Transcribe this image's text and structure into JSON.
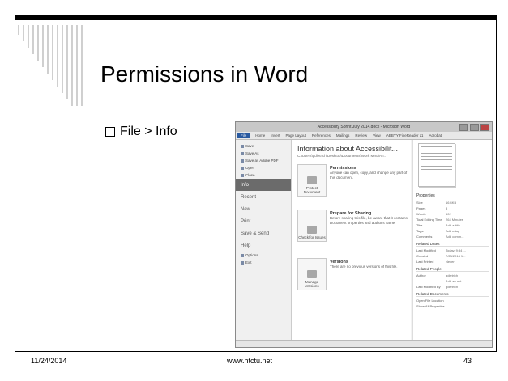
{
  "slide": {
    "title": "Permissions in Word",
    "bullet": "File > Info",
    "footer_date": "11/24/2014",
    "footer_site": "www.htctu.net",
    "footer_page": "43"
  },
  "screenshot": {
    "window_title": "Accessibility Sprint July 2014.docx - Microsoft Word",
    "tabs": [
      "File",
      "Home",
      "Insert",
      "Page Layout",
      "References",
      "Mailings",
      "Review",
      "View",
      "ABBYY FineReader 11",
      "Acrobat"
    ],
    "sidebar_small": [
      "Save",
      "Save As",
      "Save as Adobe PDF",
      "Open",
      "Close"
    ],
    "sidebar_big": [
      "Info",
      "Recent",
      "New",
      "Print",
      "Save & Send",
      "Help"
    ],
    "sidebar_bottom": [
      "Options",
      "Exit"
    ],
    "info_title": "Information about Accessibilit...",
    "info_path": "C:\\Users\\gdietrich\\Desktop\\Documents\\Work Misc\\An...",
    "permissions": {
      "button": "Protect Document",
      "heading": "Permissions",
      "desc": "Anyone can open, copy, and change any part of this document."
    },
    "sharing": {
      "button": "Check for Issues",
      "heading": "Prepare for Sharing",
      "desc": "Before sharing this file, be aware that it contains:",
      "bullet": "Document properties and author's name"
    },
    "versions": {
      "button": "Manage Versions",
      "heading": "Versions",
      "desc": "There are no previous versions of this file."
    },
    "properties_label": "Properties",
    "properties": [
      {
        "k": "Size",
        "v": "16.4KB"
      },
      {
        "k": "Pages",
        "v": "3"
      },
      {
        "k": "Words",
        "v": "502"
      },
      {
        "k": "Total Editing Time",
        "v": "264 Minutes"
      },
      {
        "k": "Title",
        "v": "Add a title"
      },
      {
        "k": "Tags",
        "v": "Add a tag"
      },
      {
        "k": "Comments",
        "v": "Add comm..."
      }
    ],
    "related_dates_label": "Related Dates",
    "related_dates": [
      {
        "k": "Last Modified",
        "v": "Today, 9:34 ..."
      },
      {
        "k": "Created",
        "v": "7/23/2014 1..."
      },
      {
        "k": "Last Printed",
        "v": "Never"
      }
    ],
    "related_people_label": "Related People",
    "related_people": [
      {
        "k": "Author",
        "v": "gdietrich"
      },
      {
        "k": "",
        "v": "Add an aut..."
      },
      {
        "k": "Last Modified By",
        "v": "gdietrich"
      }
    ],
    "related_docs_label": "Related Documents",
    "related_docs": [
      "Open File Location",
      "Show All Properties"
    ]
  }
}
